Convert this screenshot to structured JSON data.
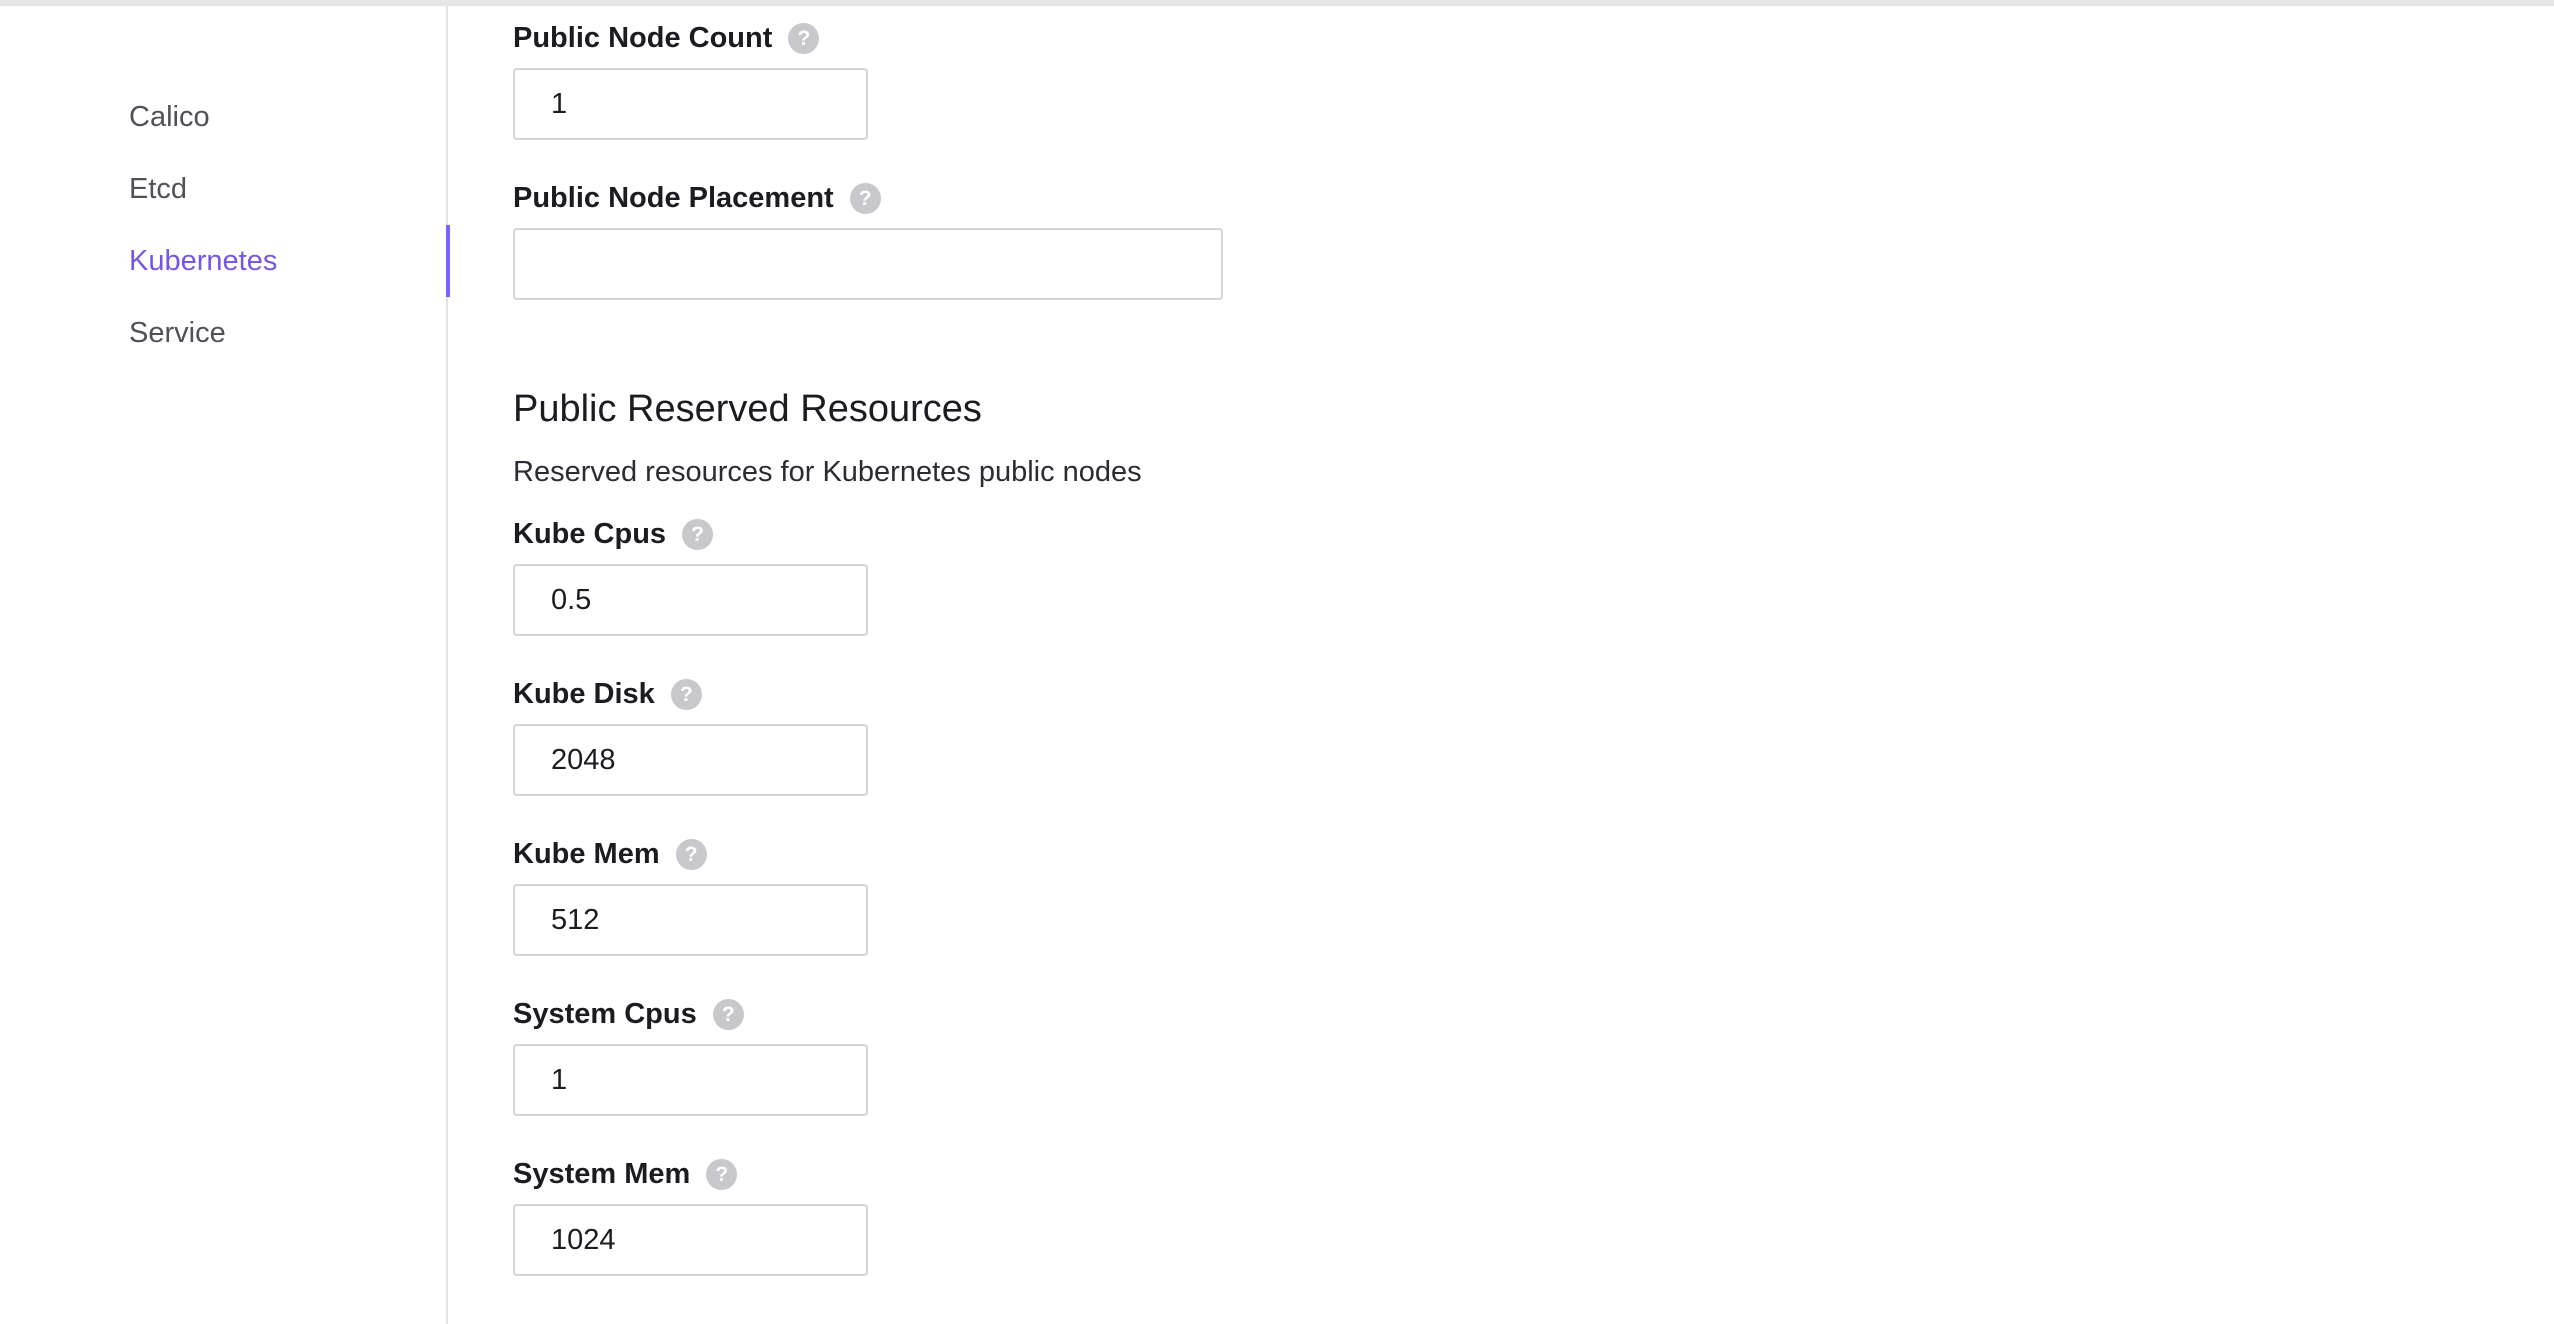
{
  "sidebar": {
    "items": [
      {
        "label": "Calico",
        "active": false
      },
      {
        "label": "Etcd",
        "active": false
      },
      {
        "label": "Kubernetes",
        "active": true
      },
      {
        "label": "Service",
        "active": false
      }
    ]
  },
  "fields": {
    "public_node_count": {
      "label": "Public Node Count",
      "value": "1"
    },
    "public_node_placement": {
      "label": "Public Node Placement",
      "value": ""
    }
  },
  "section": {
    "title": "Public Reserved Resources",
    "description": "Reserved resources for Kubernetes public nodes"
  },
  "reserved": {
    "kube_cpus": {
      "label": "Kube Cpus",
      "value": "0.5"
    },
    "kube_disk": {
      "label": "Kube Disk",
      "value": "2048"
    },
    "kube_mem": {
      "label": "Kube Mem",
      "value": "512"
    },
    "system_cpus": {
      "label": "System Cpus",
      "value": "1"
    },
    "system_mem": {
      "label": "System Mem",
      "value": "1024"
    }
  },
  "help_icon_glyph": "?",
  "colors": {
    "accent": "#7b61ff",
    "active_text": "#7656e6",
    "help_icon": "#c7c7cc"
  }
}
